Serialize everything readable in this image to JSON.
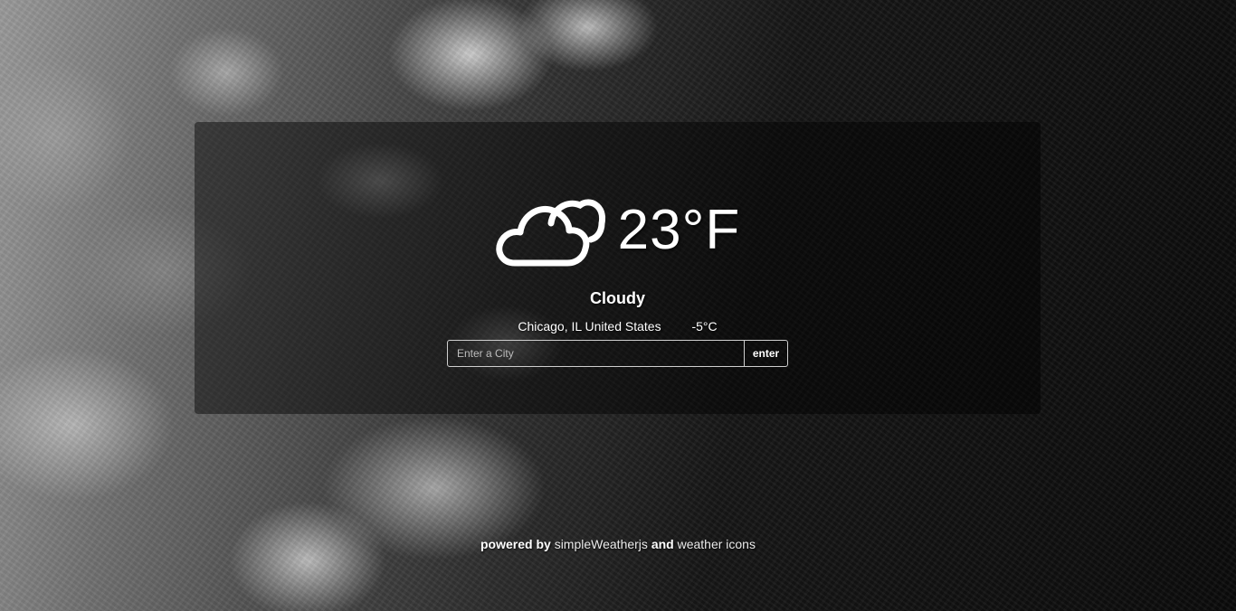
{
  "weather": {
    "icon": "cloudy-icon",
    "temperature": "23°F",
    "condition": "Cloudy",
    "location": "Chicago, IL United States",
    "alt_temperature": "-5°C"
  },
  "search": {
    "placeholder": "Enter a City",
    "value": "",
    "button_label": "enter"
  },
  "footer": {
    "powered_by": "powered by",
    "link1": "simpleWeatherjs",
    "and": "and",
    "link2": "weather icons"
  }
}
